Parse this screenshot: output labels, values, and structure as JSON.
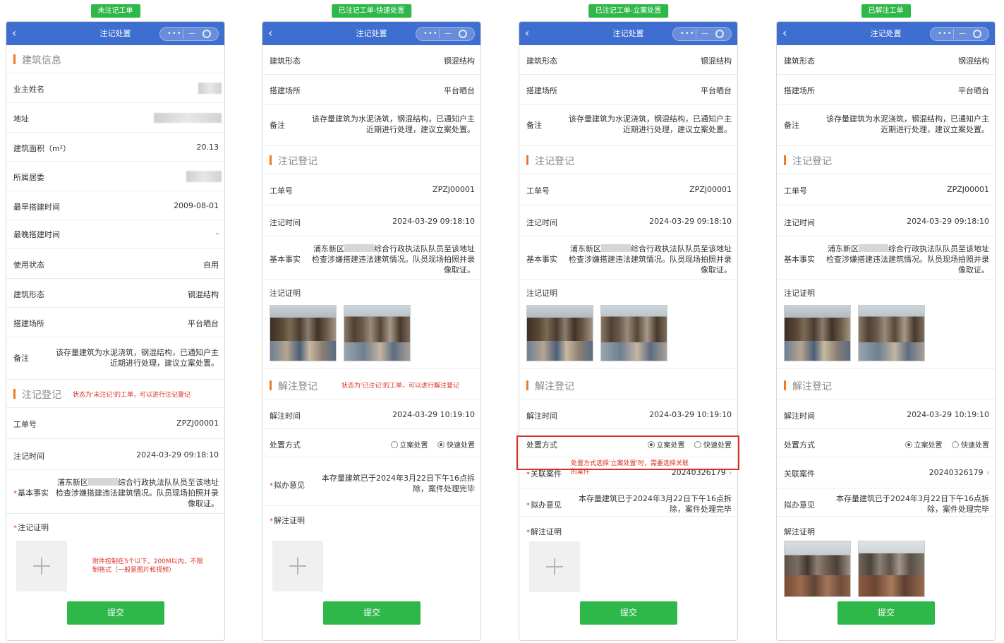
{
  "nav": {
    "back_icon": "chevron-left-icon",
    "title": "注记处置"
  },
  "common": {
    "submit_label": "提交",
    "building_form_label": "建筑形态",
    "building_form_value": "钢混结构",
    "site_label": "搭建场所",
    "site_value": "平台晒台",
    "remark_label": "备注",
    "remark_value": "该存量建筑为水泥浇筑，钢混结构，已通知户主近期进行处理，建议立案处置。",
    "reg_section": "注记登记",
    "order_label": "工单号",
    "order_value": "ZPZJ00001",
    "reg_time_label": "注记时间",
    "reg_time_value": "2024-03-29 09:18:10",
    "facts_label": "基本事实",
    "facts_prefix": "浦东新区",
    "facts_suffix": "综合行政执法队队员至该地址检查涉嫌搭建违法建筑情况。队员现场拍照并录像取证。",
    "proof_label": "注记证明",
    "unreg_section": "解注登记",
    "unreg_time_label": "解注时间",
    "unreg_time_value": "2024-03-29 10:19:10",
    "method_label": "处置方式",
    "method_case": "立案处置",
    "method_fast": "快速处置",
    "opinion_label": "拟办意见",
    "opinion_value": "本存量建筑已于2024年3月22日下午16点拆除，案件处理完毕",
    "unproof_label": "解注证明",
    "case_label": "关联案件",
    "case_value": "20240326179"
  },
  "col1": {
    "tag": "未注记工单",
    "section1": "建筑信息",
    "owner_label": "业主姓名",
    "address_label": "地址",
    "area_label": "建筑面积（m²）",
    "area_value": "20.13",
    "community_label": "所属居委",
    "earliest_label": "最早搭建时间",
    "earliest_value": "2009-08-01",
    "latest_label": "最晚搭建时间",
    "latest_value": "-",
    "usage_label": "使用状态",
    "usage_value": "自用",
    "reg_note": "状态为'未注记'的工单，可以进行注记登记",
    "upload_note": "附件控制在5个以下，200M以内，不限制格式（一般是图片和视频）"
  },
  "col2": {
    "tag": "已注记工单-快速处置",
    "unreg_note": "状态为'已注记'的工单，可以进行解注登记"
  },
  "col3": {
    "tag": "已注记工单-立案处置",
    "case_note": "处置方式选择'立案处置'时，需要选择关联的案件"
  },
  "col4": {
    "tag": "已解注工单"
  }
}
